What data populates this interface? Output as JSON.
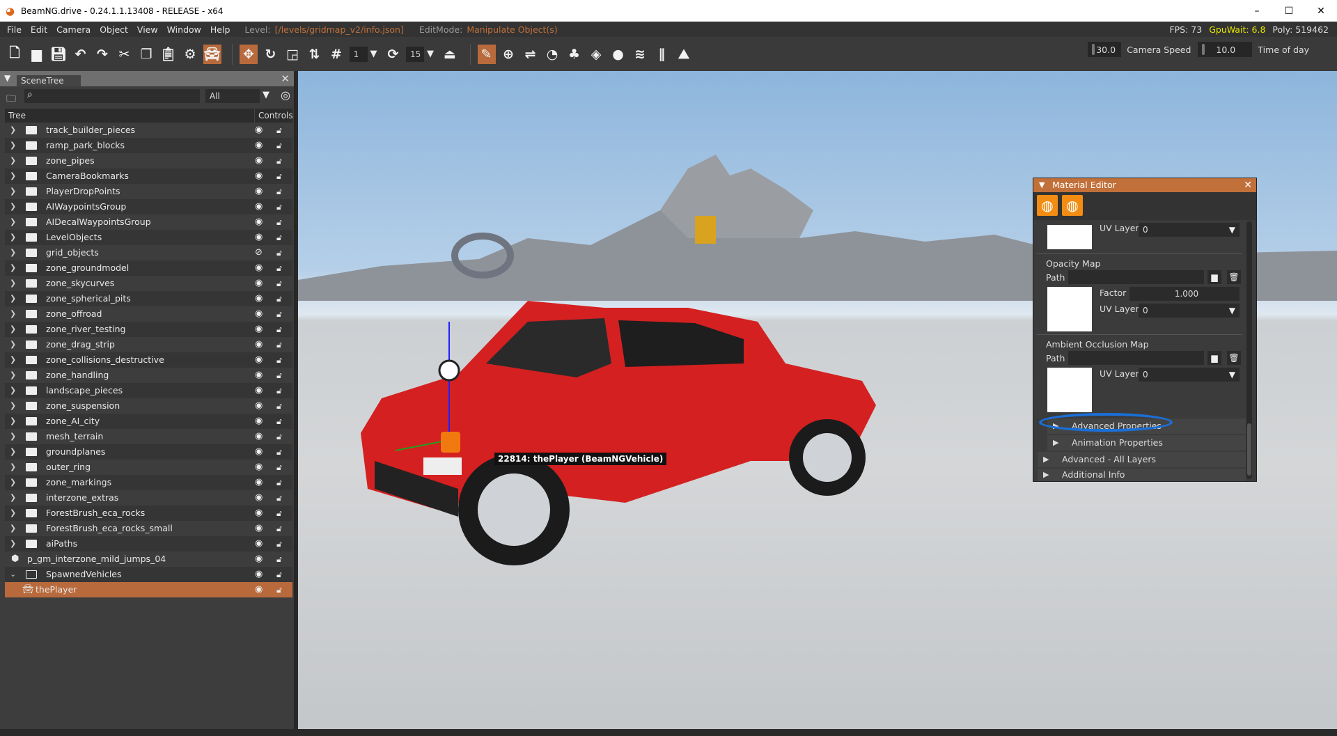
{
  "window": {
    "title": "BeamNG.drive - 0.24.1.1.13408 - RELEASE - x64",
    "minimize": "–",
    "maximize": "☐",
    "close": "✕"
  },
  "menu": {
    "items": [
      "File",
      "Edit",
      "Camera",
      "Object",
      "View",
      "Window",
      "Help"
    ],
    "level_label": "Level:",
    "level_value": "[/levels/gridmap_v2/info.json]",
    "editmode_label": "EditMode:",
    "editmode_value": "Manipulate Object(s)"
  },
  "stats": {
    "fps": "FPS: 73",
    "gpuwait": "GpuWait: 6.8",
    "poly": "Poly: 519462",
    "gpuwait_color": "#e6e600"
  },
  "toolbar": {
    "snap_value": "1",
    "rotate_snap_value": "15",
    "camera_speed_value": "30.0",
    "camera_speed_label": "Camera Speed",
    "time_of_day_value": "10.0",
    "time_of_day_label": "Time of day"
  },
  "scene_tree": {
    "tab": "SceneTree",
    "filter": "All",
    "col_tree": "Tree",
    "col_controls": "Controls",
    "items": [
      {
        "name": "track_builder_pieces",
        "type": "folder"
      },
      {
        "name": "ramp_park_blocks",
        "type": "folder"
      },
      {
        "name": "zone_pipes",
        "type": "folder"
      },
      {
        "name": "CameraBookmarks",
        "type": "folder"
      },
      {
        "name": "PlayerDropPoints",
        "type": "folder"
      },
      {
        "name": "AIWaypointsGroup",
        "type": "folder"
      },
      {
        "name": "AIDecalWaypointsGroup",
        "type": "folder"
      },
      {
        "name": "LevelObjects",
        "type": "folder"
      },
      {
        "name": "grid_objects",
        "type": "folder",
        "hidden": true
      },
      {
        "name": "zone_groundmodel",
        "type": "folder"
      },
      {
        "name": "zone_skycurves",
        "type": "folder"
      },
      {
        "name": "zone_spherical_pits",
        "type": "folder"
      },
      {
        "name": "zone_offroad",
        "type": "folder"
      },
      {
        "name": "zone_river_testing",
        "type": "folder"
      },
      {
        "name": "zone_drag_strip",
        "type": "folder"
      },
      {
        "name": "zone_collisions_destructive",
        "type": "folder"
      },
      {
        "name": "zone_handling",
        "type": "folder"
      },
      {
        "name": "landscape_pieces",
        "type": "folder"
      },
      {
        "name": "zone_suspension",
        "type": "folder"
      },
      {
        "name": "zone_AI_city",
        "type": "folder"
      },
      {
        "name": "mesh_terrain",
        "type": "folder"
      },
      {
        "name": "groundplanes",
        "type": "folder"
      },
      {
        "name": "outer_ring",
        "type": "folder"
      },
      {
        "name": "zone_markings",
        "type": "folder"
      },
      {
        "name": "interzone_extras",
        "type": "folder"
      },
      {
        "name": "ForestBrush_eca_rocks",
        "type": "folder"
      },
      {
        "name": "ForestBrush_eca_rocks_small",
        "type": "folder"
      },
      {
        "name": "aiPaths",
        "type": "folder"
      },
      {
        "name": "p_gm_interzone_mild_jumps_04",
        "type": "object"
      },
      {
        "name": "SpawnedVehicles",
        "type": "folder-open"
      },
      {
        "name": "thePlayer",
        "type": "vehicle",
        "selected": true
      }
    ]
  },
  "viewport": {
    "tooltip": "22814: thePlayer (BeamNGVehicle)"
  },
  "material_editor": {
    "title": "Material Editor",
    "uv_layer_label": "UV Layer",
    "uv_top": "0",
    "opacity_map": {
      "title": "Opacity Map",
      "path_label": "Path",
      "path": "",
      "factor_label": "Factor",
      "factor": "1.000",
      "uv_layer": "0"
    },
    "ao_map": {
      "title": "Ambient Occlusion Map",
      "path_label": "Path",
      "path": "",
      "uv_layer": "0"
    },
    "sections": [
      "Advanced Properties",
      "Animation Properties",
      "Advanced - All Layers",
      "Additional Info"
    ],
    "accent": "#c2703a",
    "annotation_color": "#1a6fd8"
  }
}
